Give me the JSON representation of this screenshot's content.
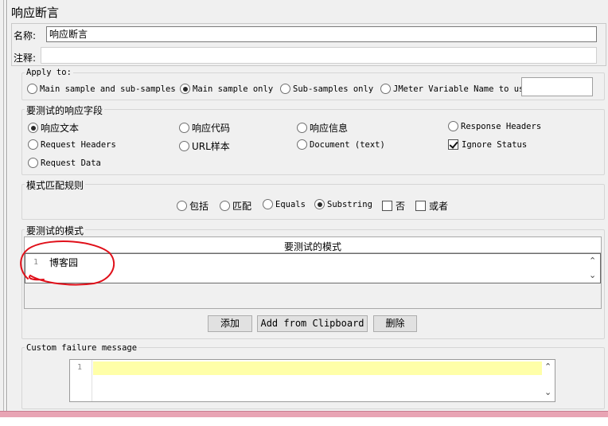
{
  "title": "响应断言",
  "name_label": "名称:",
  "name_value": "响应断言",
  "comment_label": "注释:",
  "apply_to": {
    "legend": "Apply to:",
    "options": [
      "Main sample and sub-samples",
      "Main sample only",
      "Sub-samples only",
      "JMeter Variable Name to use"
    ],
    "selected": "Main sample only"
  },
  "response_field": {
    "legend": "要测试的响应字段",
    "options": [
      "响应文本",
      "响应代码",
      "响应信息",
      "Response Headers",
      "Request Headers",
      "URL样本",
      "Document (text)",
      "Request Data"
    ],
    "selected": "响应文本",
    "ignore_status_label": "Ignore Status",
    "ignore_status_checked": true
  },
  "pattern_rules": {
    "legend": "模式匹配规则",
    "options": [
      "包括",
      "匹配",
      "Equals",
      "Substring"
    ],
    "selected": "Substring",
    "not_label": "否",
    "or_label": "或者"
  },
  "patterns": {
    "legend": "要测试的模式",
    "column_header": "要测试的模式",
    "rows": [
      {
        "line": "1",
        "value": "博客园"
      }
    ]
  },
  "buttons": {
    "add": "添加",
    "add_clipboard": "Add from Clipboard",
    "delete": "删除"
  },
  "failure": {
    "legend": "Custom failure message",
    "line": "1"
  },
  "colors": {
    "annotation": "#e0101a",
    "highlight_line": "#ffffa8",
    "status_bar": "#e8a4b4"
  }
}
